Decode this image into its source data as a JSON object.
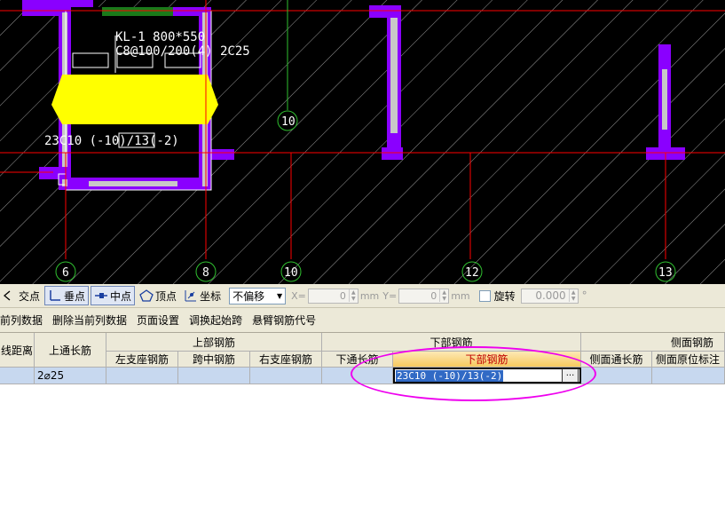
{
  "canvas": {
    "beam_label_1": "KL-1 800*550",
    "beam_label_2": "C8@100/200(4) 2C25",
    "bottom_rebar_label": "23C10 (-10)/13(-2)",
    "axis_labels": [
      "6",
      "8",
      "10",
      "12",
      "13"
    ],
    "axis_label_mid": "10"
  },
  "snap_toolbar": {
    "intersection": "交点",
    "perpendicular": "垂点",
    "midpoint": "中点",
    "vertex": "顶点",
    "coordinate": "坐标",
    "offset_select": "不偏移",
    "x_label": "X=",
    "x_value": "0",
    "y_label": "Y=",
    "y_value": "0",
    "unit": "mm",
    "rotate_label": "旋转",
    "rotate_value": "0.000",
    "degree": "°"
  },
  "action_bar": {
    "items": [
      "前列数据",
      "删除当前列数据",
      "页面设置",
      "调换起始跨",
      "悬臂钢筋代号"
    ]
  },
  "grid": {
    "headers": {
      "col0": "线距离",
      "col1": "上通长筋",
      "top_group": "上部钢筋",
      "top_sub": [
        "左支座钢筋",
        "跨中钢筋",
        "右支座钢筋"
      ],
      "bottom_group": "下部钢筋",
      "bottom_sub": [
        "下通长筋",
        "下部钢筋"
      ],
      "side_group": "侧面钢筋",
      "side_sub": [
        "侧面通长筋",
        "侧面原位标注"
      ]
    },
    "row": {
      "top_continuous": "2⌀25",
      "bottom_rebar_edit": "23C10 (-10)/13(-2)",
      "ellipsis": "..."
    }
  },
  "colors": {
    "canvas_bg": "#000000",
    "column_purple": "#8a00ff",
    "highlight_yellow": "#ffff00",
    "axis_red": "#ff0000",
    "annotation_magenta": "#ee00ee"
  }
}
